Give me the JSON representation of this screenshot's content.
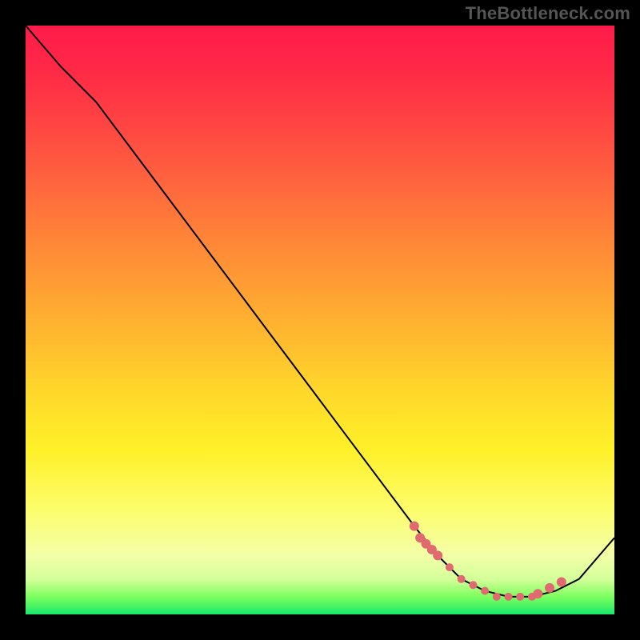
{
  "watermark": "TheBottleneck.com",
  "chart_data": {
    "type": "line",
    "title": "",
    "xlabel": "",
    "ylabel": "",
    "xlim": [
      0,
      100
    ],
    "ylim": [
      0,
      100
    ],
    "grid": false,
    "series": [
      {
        "name": "curve",
        "x": [
          0,
          6,
          12,
          18,
          24,
          30,
          36,
          42,
          48,
          54,
          60,
          66,
          70,
          74,
          78,
          82,
          86,
          90,
          94,
          100
        ],
        "y": [
          100,
          93,
          87,
          79,
          71,
          63,
          55,
          47,
          39,
          31,
          23,
          15,
          10,
          6,
          4,
          3,
          3,
          4,
          6,
          13
        ]
      }
    ],
    "markers": {
      "note": "cluster of pink markers near curve bottom",
      "x": [
        66,
        67,
        68,
        69,
        70,
        72,
        74,
        76,
        78,
        80,
        82,
        84,
        86,
        87,
        89,
        91
      ],
      "y": [
        15,
        13,
        12,
        11,
        10,
        8,
        6,
        5,
        4,
        3,
        3,
        3,
        3,
        3.5,
        4.5,
        5.5
      ]
    }
  }
}
